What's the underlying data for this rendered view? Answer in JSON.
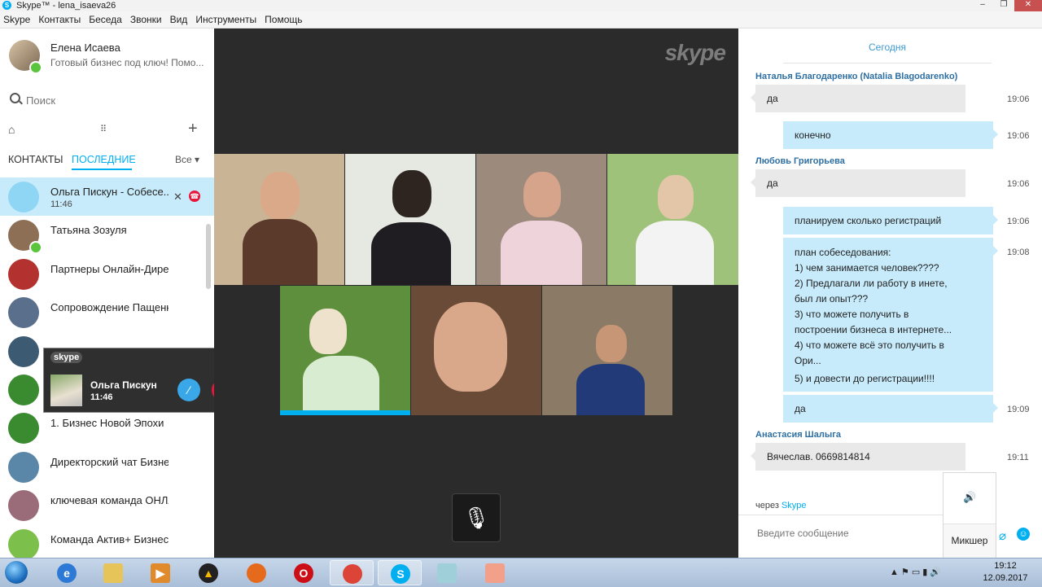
{
  "window": {
    "title": "Skype™ - lena_isaeva26",
    "min": "–",
    "max": "❐",
    "close": "✕"
  },
  "menu": [
    "Skype",
    "Контакты",
    "Беседа",
    "Звонки",
    "Вид",
    "Инструменты",
    "Помощь"
  ],
  "profile": {
    "name": "Елена Исаева",
    "status": "Готовый бизнес под ключ! Помо..."
  },
  "search": {
    "placeholder": "Поиск"
  },
  "tabs": {
    "contacts": "КОНТАКТЫ",
    "recent": "ПОСЛЕДНИЕ",
    "filter": "Все ▾"
  },
  "recent": [
    {
      "name": "Ольга Пискун - Собесе...",
      "time": "11:46",
      "color": "#8fd6f5"
    },
    {
      "name": "Татьяна Зозуля",
      "time": "",
      "color": "#8c6f55"
    },
    {
      "name": "Партнеры Онлайн-Директор",
      "time": "",
      "color": "#b3312e"
    },
    {
      "name": "Сопровождение Пащенко Иг...",
      "time": "",
      "color": "#5a6f8c"
    },
    {
      "name": "",
      "time": "",
      "color": "#3d5a73"
    },
    {
      "name": "",
      "time": "",
      "color": "#3a8a2f"
    },
    {
      "name": "1. Бизнес Новой Эпохи",
      "time": "",
      "color": "#3a8a2f"
    },
    {
      "name": "Директорский чат Бизнес Но...",
      "time": "",
      "color": "#5a87a8"
    },
    {
      "name": "ключевая команда ОНЛАЙН...",
      "time": "",
      "color": "#9a6b78"
    },
    {
      "name": "Команда Актив+ Бизнес Нов...",
      "time": "",
      "color": "#7cbf4a"
    }
  ],
  "call_popup": {
    "logo": "skype",
    "name": "Ольга Пискун",
    "time": "11:46"
  },
  "video": {
    "logo": "skype"
  },
  "chat": {
    "day": "Сегодня",
    "messages": [
      {
        "sender": "Наталья Благодаренко (Natalia Blagodarenko)",
        "text": "да",
        "time": "19:06"
      },
      {
        "text": "конечно",
        "time": "19:06"
      },
      {
        "sender": "Любовь Григорьева",
        "text": "да",
        "time": "19:06"
      },
      {
        "text": "планируем сколько регистраций",
        "time": "19:06"
      },
      {
        "lines": [
          "план собеседования:",
          "1) чем занимается человек????",
          "2) Предлагали ли работу в инете,",
          "был ли опыт???",
          "3) что можете получить в",
          "построении бизнеса в интернете...",
          "4) что можете всё это получить в",
          "Ори...",
          "5) и довести до регистрации!!!!"
        ],
        "time": "19:08"
      },
      {
        "text": "да",
        "time": "19:09"
      },
      {
        "sender": "Анастасия Шалыга",
        "text": "Вячеслав. 0669814814",
        "time": "19:11"
      }
    ],
    "via_prefix": "через",
    "via_link": "Skype",
    "input_placeholder": "Введите сообщение",
    "mixer": "Микшер"
  },
  "taskbar": {
    "time": "19:12",
    "date": "12.09.2017"
  }
}
